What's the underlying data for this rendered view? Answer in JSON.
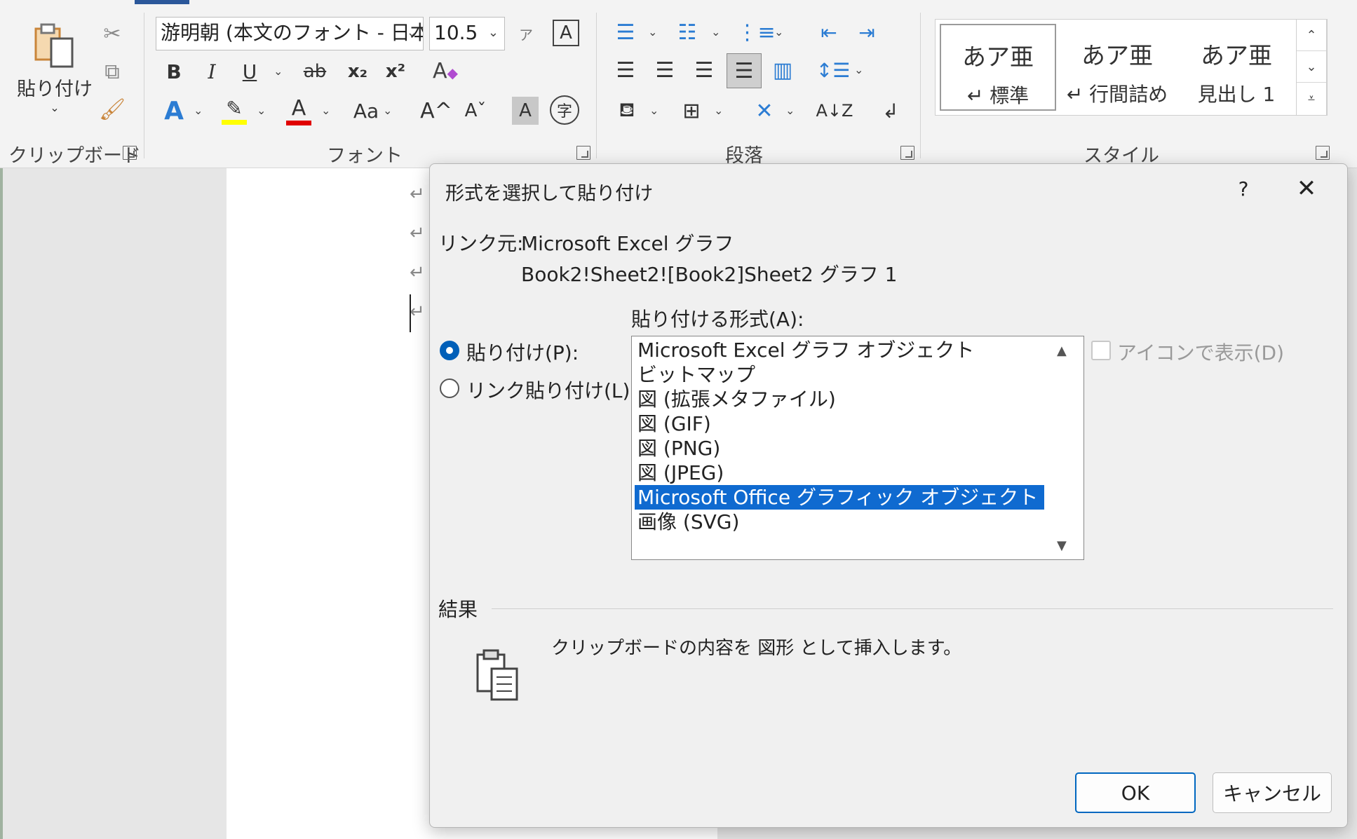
{
  "ribbon": {
    "clipboard": {
      "paste_label": "貼り付け",
      "group_label": "クリップボード"
    },
    "font": {
      "font_name": "游明朝 (本文のフォント - 日本",
      "font_size": "10.5",
      "group_label": "フォント",
      "bold": "B",
      "italic": "I",
      "underline": "U",
      "strike": "ab",
      "subscript": "x₂",
      "superscript": "x²",
      "case": "Aa",
      "grow": "A^",
      "shrink": "Aˇ",
      "char_shade": "A",
      "enclose": "字",
      "font_color": "A",
      "text_effect": "A"
    },
    "paragraph": {
      "group_label": "段落"
    },
    "styles": {
      "group_label": "スタイル",
      "items": [
        {
          "preview": "あア亜",
          "label": "↵ 標準"
        },
        {
          "preview": "あア亜",
          "label": "↵ 行間詰め"
        },
        {
          "preview": "あア亜",
          "label": "見出し 1"
        }
      ]
    },
    "colors": {
      "highlight": "#ffff00",
      "font_color": "#e00000",
      "accent": "#2b579a"
    }
  },
  "dialog": {
    "title": "形式を選択して貼り付け",
    "help": "?",
    "close": "✕",
    "source_label": "リンク元:",
    "source_line1": "Microsoft Excel グラフ",
    "source_line2": "Book2!Sheet2![Book2]Sheet2 グラフ 1",
    "format_label": "貼り付ける形式(A):",
    "paste_option": "貼り付け(P):",
    "paste_link_option": "リンク貼り付け(L):",
    "formats": [
      "Microsoft Excel グラフ オブジェクト",
      "ビットマップ",
      "図 (拡張メタファイル)",
      "図 (GIF)",
      "図 (PNG)",
      "図 (JPEG)",
      "Microsoft Office グラフィック オブジェクト",
      "画像 (SVG)"
    ],
    "selected_format": "Microsoft Office グラフィック オブジェクト",
    "icon_display": "アイコンで表示(D)",
    "result_label": "結果",
    "result_text": "クリップボードの内容を 図形 として挿入します。",
    "ok": "OK",
    "cancel": "キャンセル",
    "accent_color": "#0f6ad0"
  }
}
